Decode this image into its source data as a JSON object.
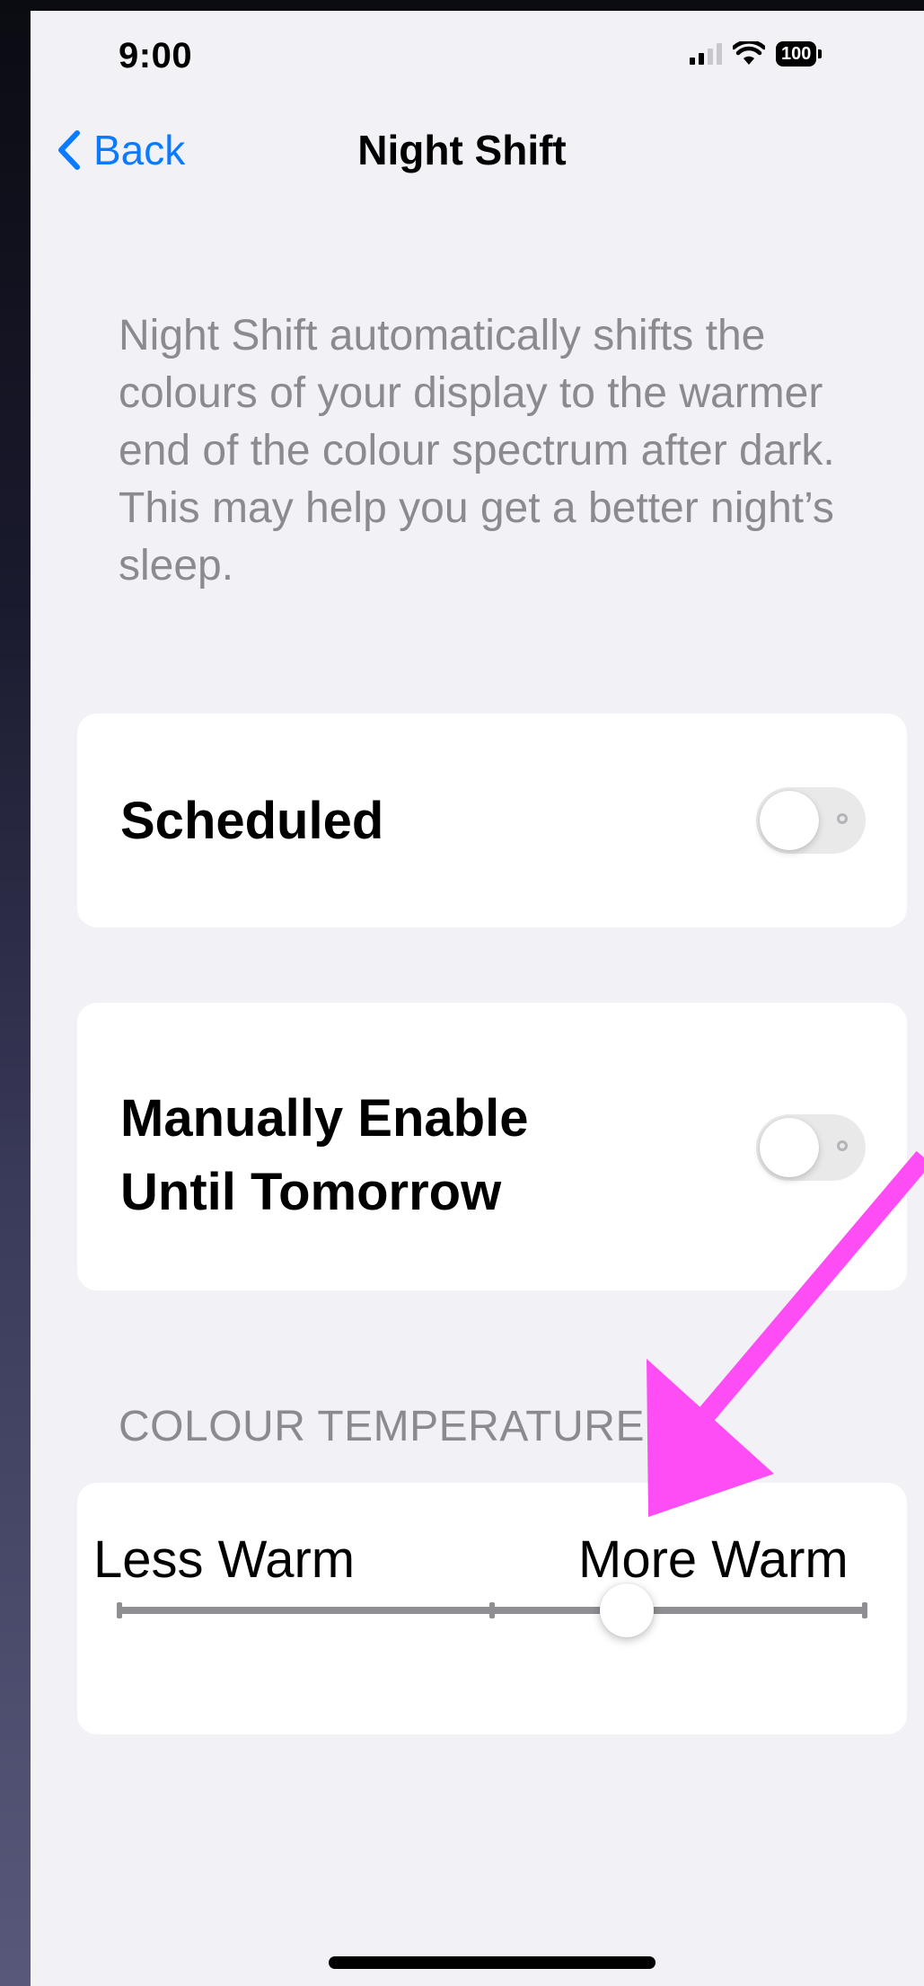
{
  "status_bar": {
    "time": "9:00",
    "battery": "100"
  },
  "nav": {
    "back_label": "Back",
    "title": "Night Shift"
  },
  "description": "Night Shift automatically shifts the colours of your display to the warmer end of the colour spectrum after dark. This may help you get a better night’s sleep.",
  "settings": {
    "scheduled": {
      "label": "Scheduled",
      "on": false
    },
    "manual": {
      "label": "Manually Enable Until Tomorrow",
      "on": false
    }
  },
  "colour_temperature": {
    "header": "COLOUR TEMPERATURE",
    "min_label": "Less Warm",
    "max_label": "More Warm",
    "value": 0.68
  },
  "annotation": {
    "arrow_color": "#ff4df5"
  },
  "colors": {
    "accent": "#0a7aff",
    "background": "#f1f1f6",
    "secondary_text": "#8a8a8f"
  }
}
